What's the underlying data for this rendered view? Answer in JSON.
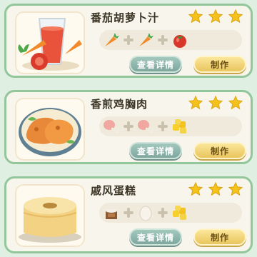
{
  "recipes": [
    {
      "name": "番茄胡萝卜汁",
      "stars": 3,
      "ingredients": [
        "carrot-icon",
        "carrot-icon",
        "tomato-icon"
      ],
      "view_label": "查看详情",
      "make_label": "制作"
    },
    {
      "name": "香煎鸡胸肉",
      "stars": 3,
      "ingredients": [
        "chicken-leg-icon",
        "chicken-leg-icon",
        "butter-cubes-icon"
      ],
      "view_label": "查看详情",
      "make_label": "制作"
    },
    {
      "name": "戚风蛋糕",
      "stars": 3,
      "ingredients": [
        "flour-sack-icon",
        "egg-icon",
        "butter-cubes-icon"
      ],
      "view_label": "查看详情",
      "make_label": "制作"
    }
  ],
  "colors": {
    "background": "#dff0e2",
    "card_border": "#93c69a",
    "star": "#f5c21b",
    "view_button": "#8fb6ab",
    "make_button": "#f2d67a"
  }
}
